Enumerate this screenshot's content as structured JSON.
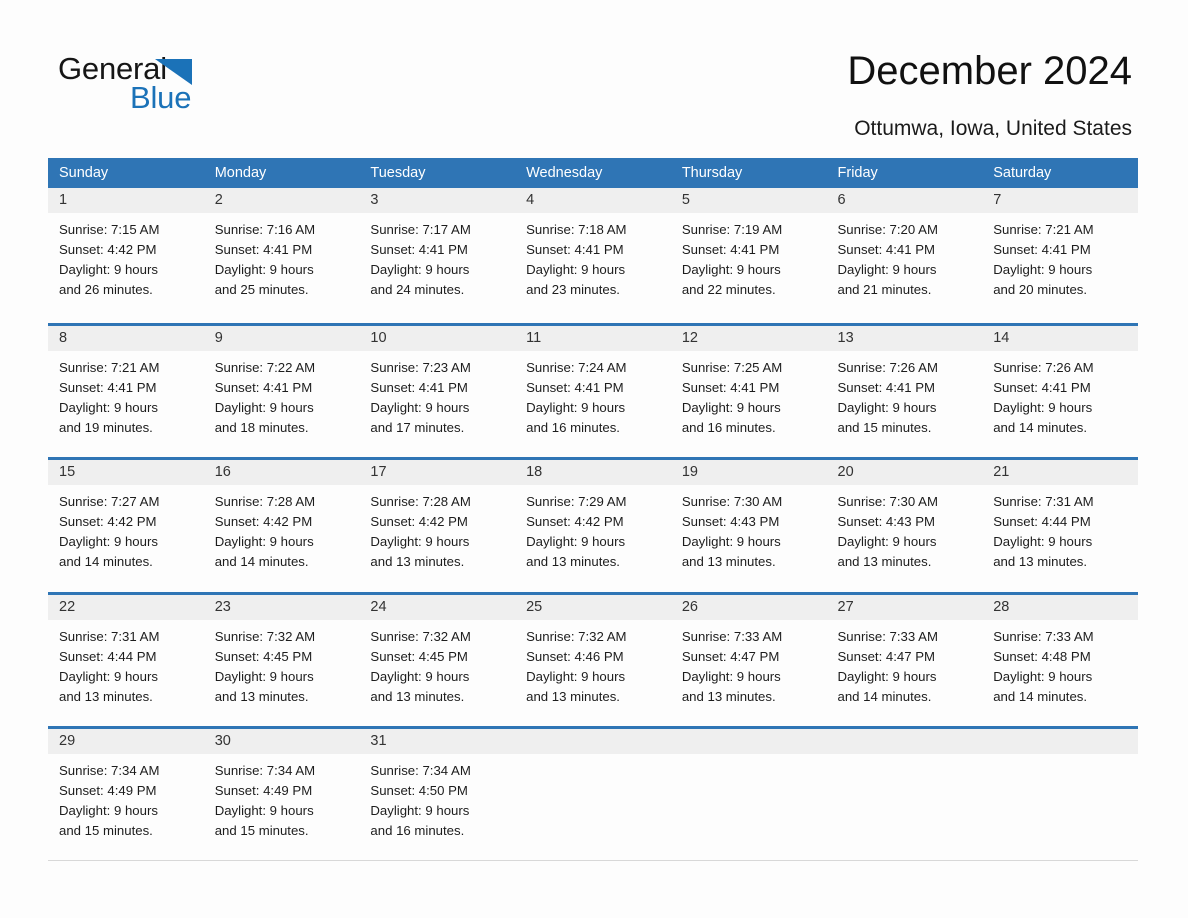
{
  "brand": {
    "name_part1": "General",
    "name_part2": "Blue",
    "accent_color": "#1b72b8"
  },
  "header": {
    "title": "December 2024",
    "subtitle": "Ottumwa, Iowa, United States"
  },
  "calendar": {
    "header_bg": "#2f75b5",
    "daynum_bg": "#efefef",
    "day_names": [
      "Sunday",
      "Monday",
      "Tuesday",
      "Wednesday",
      "Thursday",
      "Friday",
      "Saturday"
    ],
    "labels": {
      "sunrise": "Sunrise:",
      "sunset": "Sunset:",
      "daylight": "Daylight:"
    },
    "weeks": [
      [
        {
          "day": "1",
          "sunrise": "Sunrise: 7:15 AM",
          "sunset": "Sunset: 4:42 PM",
          "daylight_line1": "Daylight: 9 hours",
          "daylight_line2": "and 26 minutes."
        },
        {
          "day": "2",
          "sunrise": "Sunrise: 7:16 AM",
          "sunset": "Sunset: 4:41 PM",
          "daylight_line1": "Daylight: 9 hours",
          "daylight_line2": "and 25 minutes."
        },
        {
          "day": "3",
          "sunrise": "Sunrise: 7:17 AM",
          "sunset": "Sunset: 4:41 PM",
          "daylight_line1": "Daylight: 9 hours",
          "daylight_line2": "and 24 minutes."
        },
        {
          "day": "4",
          "sunrise": "Sunrise: 7:18 AM",
          "sunset": "Sunset: 4:41 PM",
          "daylight_line1": "Daylight: 9 hours",
          "daylight_line2": "and 23 minutes."
        },
        {
          "day": "5",
          "sunrise": "Sunrise: 7:19 AM",
          "sunset": "Sunset: 4:41 PM",
          "daylight_line1": "Daylight: 9 hours",
          "daylight_line2": "and 22 minutes."
        },
        {
          "day": "6",
          "sunrise": "Sunrise: 7:20 AM",
          "sunset": "Sunset: 4:41 PM",
          "daylight_line1": "Daylight: 9 hours",
          "daylight_line2": "and 21 minutes."
        },
        {
          "day": "7",
          "sunrise": "Sunrise: 7:21 AM",
          "sunset": "Sunset: 4:41 PM",
          "daylight_line1": "Daylight: 9 hours",
          "daylight_line2": "and 20 minutes."
        }
      ],
      [
        {
          "day": "8",
          "sunrise": "Sunrise: 7:21 AM",
          "sunset": "Sunset: 4:41 PM",
          "daylight_line1": "Daylight: 9 hours",
          "daylight_line2": "and 19 minutes."
        },
        {
          "day": "9",
          "sunrise": "Sunrise: 7:22 AM",
          "sunset": "Sunset: 4:41 PM",
          "daylight_line1": "Daylight: 9 hours",
          "daylight_line2": "and 18 minutes."
        },
        {
          "day": "10",
          "sunrise": "Sunrise: 7:23 AM",
          "sunset": "Sunset: 4:41 PM",
          "daylight_line1": "Daylight: 9 hours",
          "daylight_line2": "and 17 minutes."
        },
        {
          "day": "11",
          "sunrise": "Sunrise: 7:24 AM",
          "sunset": "Sunset: 4:41 PM",
          "daylight_line1": "Daylight: 9 hours",
          "daylight_line2": "and 16 minutes."
        },
        {
          "day": "12",
          "sunrise": "Sunrise: 7:25 AM",
          "sunset": "Sunset: 4:41 PM",
          "daylight_line1": "Daylight: 9 hours",
          "daylight_line2": "and 16 minutes."
        },
        {
          "day": "13",
          "sunrise": "Sunrise: 7:26 AM",
          "sunset": "Sunset: 4:41 PM",
          "daylight_line1": "Daylight: 9 hours",
          "daylight_line2": "and 15 minutes."
        },
        {
          "day": "14",
          "sunrise": "Sunrise: 7:26 AM",
          "sunset": "Sunset: 4:41 PM",
          "daylight_line1": "Daylight: 9 hours",
          "daylight_line2": "and 14 minutes."
        }
      ],
      [
        {
          "day": "15",
          "sunrise": "Sunrise: 7:27 AM",
          "sunset": "Sunset: 4:42 PM",
          "daylight_line1": "Daylight: 9 hours",
          "daylight_line2": "and 14 minutes."
        },
        {
          "day": "16",
          "sunrise": "Sunrise: 7:28 AM",
          "sunset": "Sunset: 4:42 PM",
          "daylight_line1": "Daylight: 9 hours",
          "daylight_line2": "and 14 minutes."
        },
        {
          "day": "17",
          "sunrise": "Sunrise: 7:28 AM",
          "sunset": "Sunset: 4:42 PM",
          "daylight_line1": "Daylight: 9 hours",
          "daylight_line2": "and 13 minutes."
        },
        {
          "day": "18",
          "sunrise": "Sunrise: 7:29 AM",
          "sunset": "Sunset: 4:42 PM",
          "daylight_line1": "Daylight: 9 hours",
          "daylight_line2": "and 13 minutes."
        },
        {
          "day": "19",
          "sunrise": "Sunrise: 7:30 AM",
          "sunset": "Sunset: 4:43 PM",
          "daylight_line1": "Daylight: 9 hours",
          "daylight_line2": "and 13 minutes."
        },
        {
          "day": "20",
          "sunrise": "Sunrise: 7:30 AM",
          "sunset": "Sunset: 4:43 PM",
          "daylight_line1": "Daylight: 9 hours",
          "daylight_line2": "and 13 minutes."
        },
        {
          "day": "21",
          "sunrise": "Sunrise: 7:31 AM",
          "sunset": "Sunset: 4:44 PM",
          "daylight_line1": "Daylight: 9 hours",
          "daylight_line2": "and 13 minutes."
        }
      ],
      [
        {
          "day": "22",
          "sunrise": "Sunrise: 7:31 AM",
          "sunset": "Sunset: 4:44 PM",
          "daylight_line1": "Daylight: 9 hours",
          "daylight_line2": "and 13 minutes."
        },
        {
          "day": "23",
          "sunrise": "Sunrise: 7:32 AM",
          "sunset": "Sunset: 4:45 PM",
          "daylight_line1": "Daylight: 9 hours",
          "daylight_line2": "and 13 minutes."
        },
        {
          "day": "24",
          "sunrise": "Sunrise: 7:32 AM",
          "sunset": "Sunset: 4:45 PM",
          "daylight_line1": "Daylight: 9 hours",
          "daylight_line2": "and 13 minutes."
        },
        {
          "day": "25",
          "sunrise": "Sunrise: 7:32 AM",
          "sunset": "Sunset: 4:46 PM",
          "daylight_line1": "Daylight: 9 hours",
          "daylight_line2": "and 13 minutes."
        },
        {
          "day": "26",
          "sunrise": "Sunrise: 7:33 AM",
          "sunset": "Sunset: 4:47 PM",
          "daylight_line1": "Daylight: 9 hours",
          "daylight_line2": "and 13 minutes."
        },
        {
          "day": "27",
          "sunrise": "Sunrise: 7:33 AM",
          "sunset": "Sunset: 4:47 PM",
          "daylight_line1": "Daylight: 9 hours",
          "daylight_line2": "and 14 minutes."
        },
        {
          "day": "28",
          "sunrise": "Sunrise: 7:33 AM",
          "sunset": "Sunset: 4:48 PM",
          "daylight_line1": "Daylight: 9 hours",
          "daylight_line2": "and 14 minutes."
        }
      ],
      [
        {
          "day": "29",
          "sunrise": "Sunrise: 7:34 AM",
          "sunset": "Sunset: 4:49 PM",
          "daylight_line1": "Daylight: 9 hours",
          "daylight_line2": "and 15 minutes."
        },
        {
          "day": "30",
          "sunrise": "Sunrise: 7:34 AM",
          "sunset": "Sunset: 4:49 PM",
          "daylight_line1": "Daylight: 9 hours",
          "daylight_line2": "and 15 minutes."
        },
        {
          "day": "31",
          "sunrise": "Sunrise: 7:34 AM",
          "sunset": "Sunset: 4:50 PM",
          "daylight_line1": "Daylight: 9 hours",
          "daylight_line2": "and 16 minutes."
        },
        {
          "day": "",
          "sunrise": "",
          "sunset": "",
          "daylight_line1": "",
          "daylight_line2": "",
          "empty": true
        },
        {
          "day": "",
          "sunrise": "",
          "sunset": "",
          "daylight_line1": "",
          "daylight_line2": "",
          "empty": true
        },
        {
          "day": "",
          "sunrise": "",
          "sunset": "",
          "daylight_line1": "",
          "daylight_line2": "",
          "empty": true
        },
        {
          "day": "",
          "sunrise": "",
          "sunset": "",
          "daylight_line1": "",
          "daylight_line2": "",
          "empty": true
        }
      ]
    ]
  }
}
